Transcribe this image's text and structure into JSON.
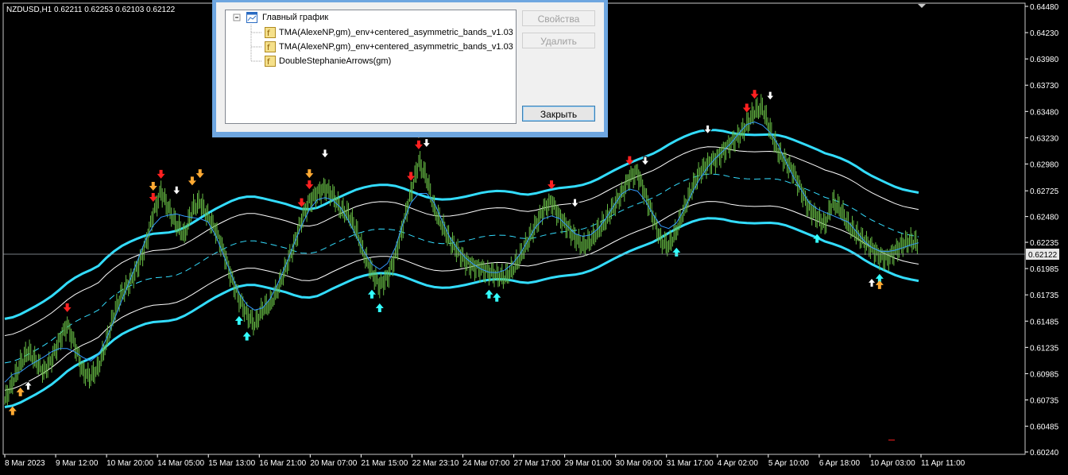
{
  "symbol_info": "NZDUSD,H1  0.62211 0.62253 0.62103 0.62122",
  "current_price_label": "0.62122",
  "colors": {
    "background": "#000000",
    "axis": "#ffffff",
    "bands_outer": "#33ddff",
    "bands_inner": "#ffffff",
    "midline": "#3399ff",
    "price": "#66bb44",
    "sell_arrow": "#ff2020",
    "buy_arrow": "#33ffff",
    "orange_arrow": "#ffaa33",
    "dialog_frame": "#6ea6e0"
  },
  "price_axis": {
    "labels": [
      "0.64480",
      "0.64230",
      "0.63980",
      "0.63730",
      "0.63480",
      "0.63230",
      "0.62980",
      "0.62725",
      "0.62480",
      "0.62235",
      "0.61985",
      "0.61735",
      "0.61485",
      "0.61235",
      "0.60985",
      "0.60735",
      "0.60485",
      "0.60240"
    ]
  },
  "time_axis": {
    "labels": [
      "8 Mar 2023",
      "9 Mar 12:00",
      "10 Mar 20:00",
      "14 Mar 05:00",
      "15 Mar 13:00",
      "16 Mar 21:00",
      "20 Mar 07:00",
      "21 Mar 15:00",
      "22 Mar 23:10",
      "24 Mar 07:00",
      "27 Mar 17:00",
      "29 Mar 01:00",
      "30 Mar 09:00",
      "31 Mar 17:00",
      "4 Apr 02:00",
      "5 Apr 10:00",
      "6 Apr 18:00",
      "10 Apr 03:00",
      "11 Apr 11:00"
    ]
  },
  "chart_data": {
    "type": "line",
    "title": "NZDUSD,H1",
    "ylim": [
      0.6024,
      0.6448
    ],
    "series": [
      {
        "name": "price",
        "values": [
          0.6073,
          0.609,
          0.6108,
          0.612,
          0.611,
          0.61,
          0.6112,
          0.613,
          0.6145,
          0.6125,
          0.61,
          0.6095,
          0.6105,
          0.6128,
          0.6155,
          0.6175,
          0.6185,
          0.62,
          0.622,
          0.625,
          0.6272,
          0.6255,
          0.624,
          0.623,
          0.6255,
          0.6262,
          0.6248,
          0.6235,
          0.6215,
          0.619,
          0.617,
          0.6155,
          0.6145,
          0.616,
          0.6165,
          0.618,
          0.62,
          0.622,
          0.6245,
          0.6262,
          0.627,
          0.6275,
          0.6268,
          0.6255,
          0.625,
          0.6235,
          0.6212,
          0.6195,
          0.6182,
          0.619,
          0.621,
          0.624,
          0.627,
          0.63,
          0.6285,
          0.6255,
          0.624,
          0.6225,
          0.6215,
          0.6205,
          0.62,
          0.6198,
          0.6195,
          0.6192,
          0.619,
          0.6198,
          0.621,
          0.6225,
          0.624,
          0.6255,
          0.6262,
          0.6248,
          0.6238,
          0.6228,
          0.622,
          0.6225,
          0.6235,
          0.6245,
          0.6258,
          0.627,
          0.6285,
          0.629,
          0.6268,
          0.6248,
          0.6225,
          0.622,
          0.6235,
          0.6255,
          0.6275,
          0.629,
          0.6298,
          0.6302,
          0.631,
          0.6318,
          0.6325,
          0.6335,
          0.6348,
          0.6352,
          0.633,
          0.631,
          0.63,
          0.629,
          0.6272,
          0.6255,
          0.6248,
          0.624,
          0.6262,
          0.6255,
          0.624,
          0.6232,
          0.6225,
          0.6218,
          0.621,
          0.6208,
          0.6215,
          0.6222,
          0.6225,
          0.6222
        ]
      }
    ]
  },
  "dialog": {
    "tree": {
      "root_label": "Главный график",
      "items": [
        "TMA(AlexeNP,gm)_env+centered_asymmetric_bands_v1.03",
        "TMA(AlexeNP,gm)_env+centered_asymmetric_bands_v1.03",
        "DoubleStephanieArrows(gm)"
      ]
    },
    "buttons": {
      "properties": "Свойства",
      "delete": "Удалить",
      "close": "Закрыть"
    }
  }
}
